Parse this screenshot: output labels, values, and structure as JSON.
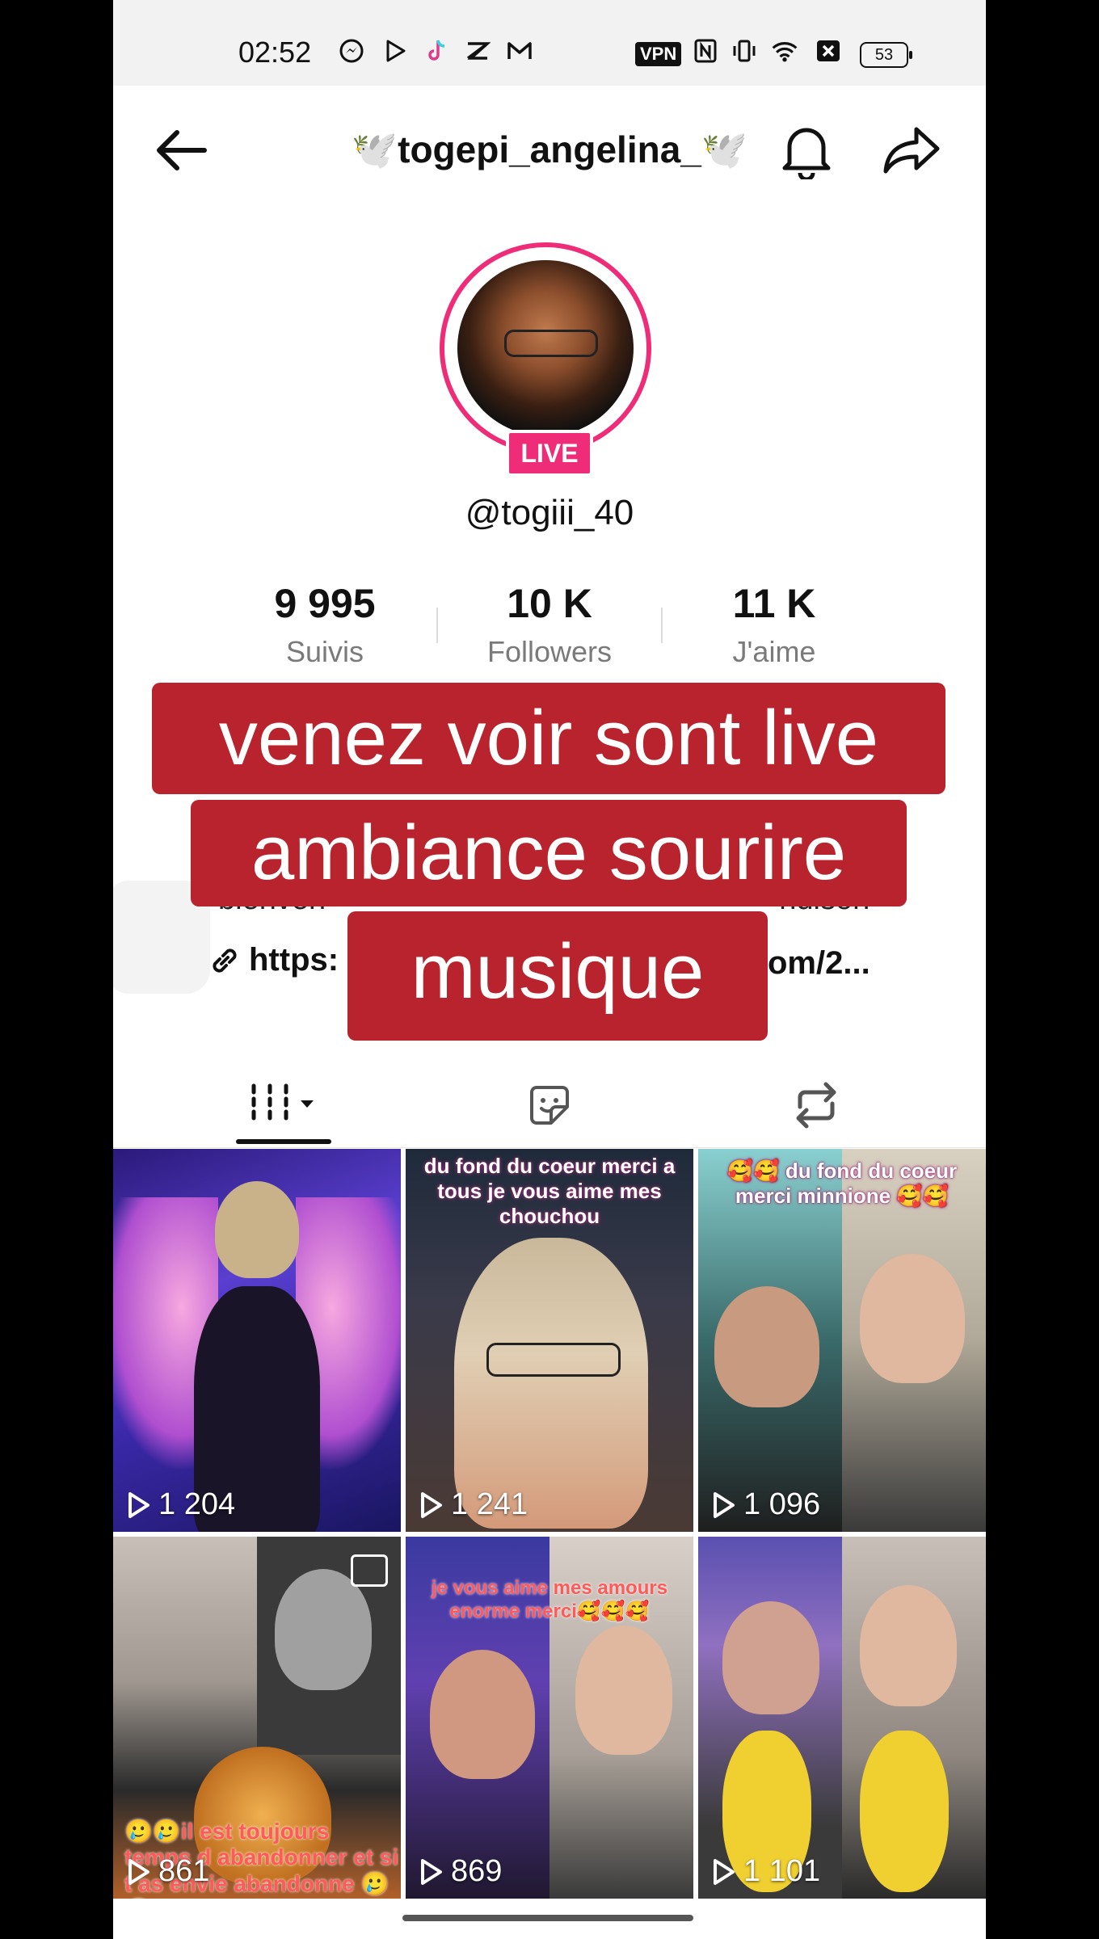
{
  "status_bar": {
    "time": "02:52",
    "vpn": "VPN",
    "battery": "53",
    "icons": [
      "messenger-icon",
      "play-store-icon",
      "tiktok-icon",
      "capcut-icon",
      "gmail-icon",
      "nfc-icon",
      "vibrate-icon",
      "wifi-icon",
      "sim-icon",
      "battery-icon"
    ]
  },
  "header": {
    "title": "🕊️togepi_angelina_🕊️",
    "back_icon": "back-arrow-icon",
    "bell_icon": "bell-icon",
    "share_icon": "share-icon"
  },
  "profile": {
    "live_badge": "LIVE",
    "username": "@togiii_40",
    "stats": [
      {
        "value": "9 995",
        "label": "Suivis"
      },
      {
        "value": "10 K",
        "label": "Followers"
      },
      {
        "value": "11 K",
        "label": "J'aime"
      }
    ],
    "bio_fragment": "bienven",
    "bio_fragment_end": "ndison",
    "link_start": "https:",
    "link_end": "om/2..."
  },
  "caption_overlay": {
    "line1": "venez voir sont live",
    "line2": "ambiance sourire",
    "line3": "musique"
  },
  "tabs": [
    {
      "name": "videos",
      "icon": "grid-videos-icon",
      "active": true
    },
    {
      "name": "favorites",
      "icon": "sticker-icon",
      "active": false
    },
    {
      "name": "reposts",
      "icon": "repost-icon",
      "active": false
    }
  ],
  "videos": [
    {
      "views": "1 204",
      "caption": ""
    },
    {
      "views": "1 241",
      "caption": "du fond du coeur merci a tous je vous aime mes chouchou"
    },
    {
      "views": "1 096",
      "caption": "🥰🥰 du fond du coeur merci minnione 🥰🥰"
    },
    {
      "views": "861",
      "caption": "🥲🥲il est toujours temps d abandonner et si t as envie abandonne 🥲🥲"
    },
    {
      "views": "869",
      "caption": "je vous aime mes amours enorme merci🥰🥰🥰"
    },
    {
      "views": "1 101",
      "caption": ""
    }
  ]
}
